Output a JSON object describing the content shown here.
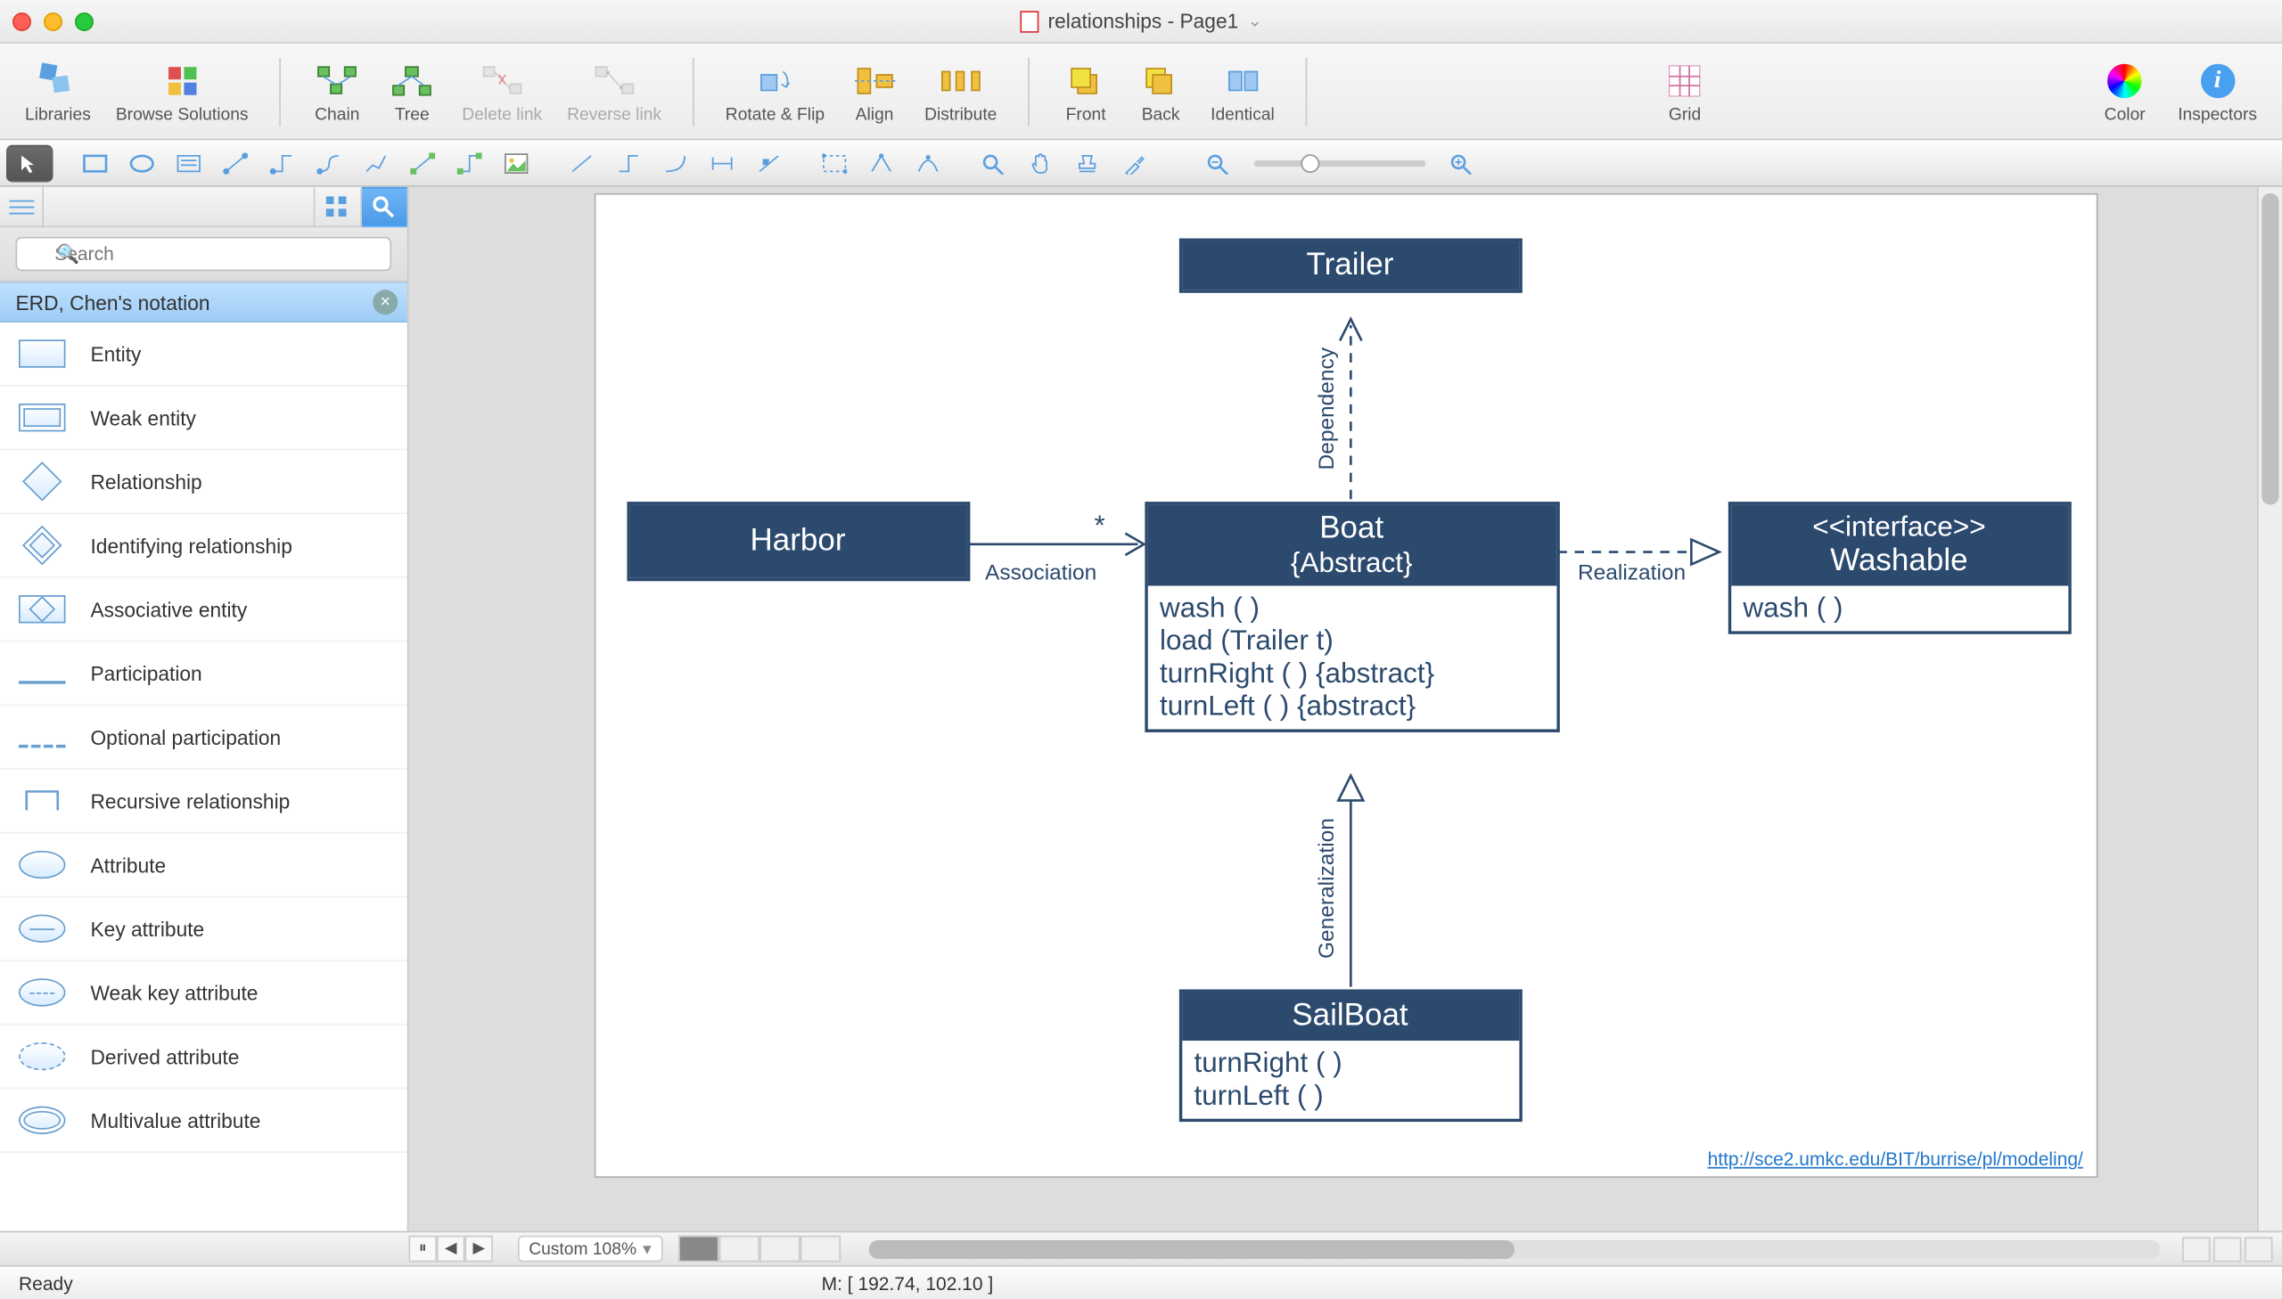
{
  "window": {
    "title": "relationships - Page1"
  },
  "toolbar": {
    "libraries": "Libraries",
    "browse": "Browse Solutions",
    "chain": "Chain",
    "tree": "Tree",
    "delete_link": "Delete link",
    "reverse_link": "Reverse link",
    "rotate_flip": "Rotate & Flip",
    "align": "Align",
    "distribute": "Distribute",
    "front": "Front",
    "back": "Back",
    "identical": "Identical",
    "grid": "Grid",
    "color": "Color",
    "inspectors": "Inspectors"
  },
  "search": {
    "placeholder": "Search"
  },
  "library": {
    "title": "ERD, Chen's notation",
    "items": [
      "Entity",
      "Weak entity",
      "Relationship",
      "Identifying relationship",
      "Associative entity",
      "Participation",
      "Optional participation",
      "Recursive relationship",
      "Attribute",
      "Key attribute",
      "Weak key attribute",
      "Derived attribute",
      "Multivalue attribute"
    ]
  },
  "diagram": {
    "trailer": "Trailer",
    "harbor": "Harbor",
    "boat_title": "Boat",
    "boat_sub": "{Abstract}",
    "boat_ops": [
      "wash ( )",
      "load (Trailer t)",
      "turnRight ( ) {abstract}",
      "turnLeft ( ) {abstract}"
    ],
    "interface_stereo": "<<interface>>",
    "interface_name": "Washable",
    "interface_ops": [
      "wash ( )"
    ],
    "sailboat": "SailBoat",
    "sailboat_ops": [
      "turnRight ( )",
      "turnLeft ( )"
    ],
    "assoc_label": "Association",
    "assoc_mult": "*",
    "dep_label": "Dependency",
    "gen_label": "Generalization",
    "real_label": "Realization",
    "footer_url": "http://sce2.umkc.edu/BIT/burrise/pl/modeling/"
  },
  "bottom": {
    "zoom": "Custom 108%",
    "pages": 4
  },
  "status": {
    "left": "Ready",
    "mouse": "M: [ 192.74, 102.10 ]"
  }
}
